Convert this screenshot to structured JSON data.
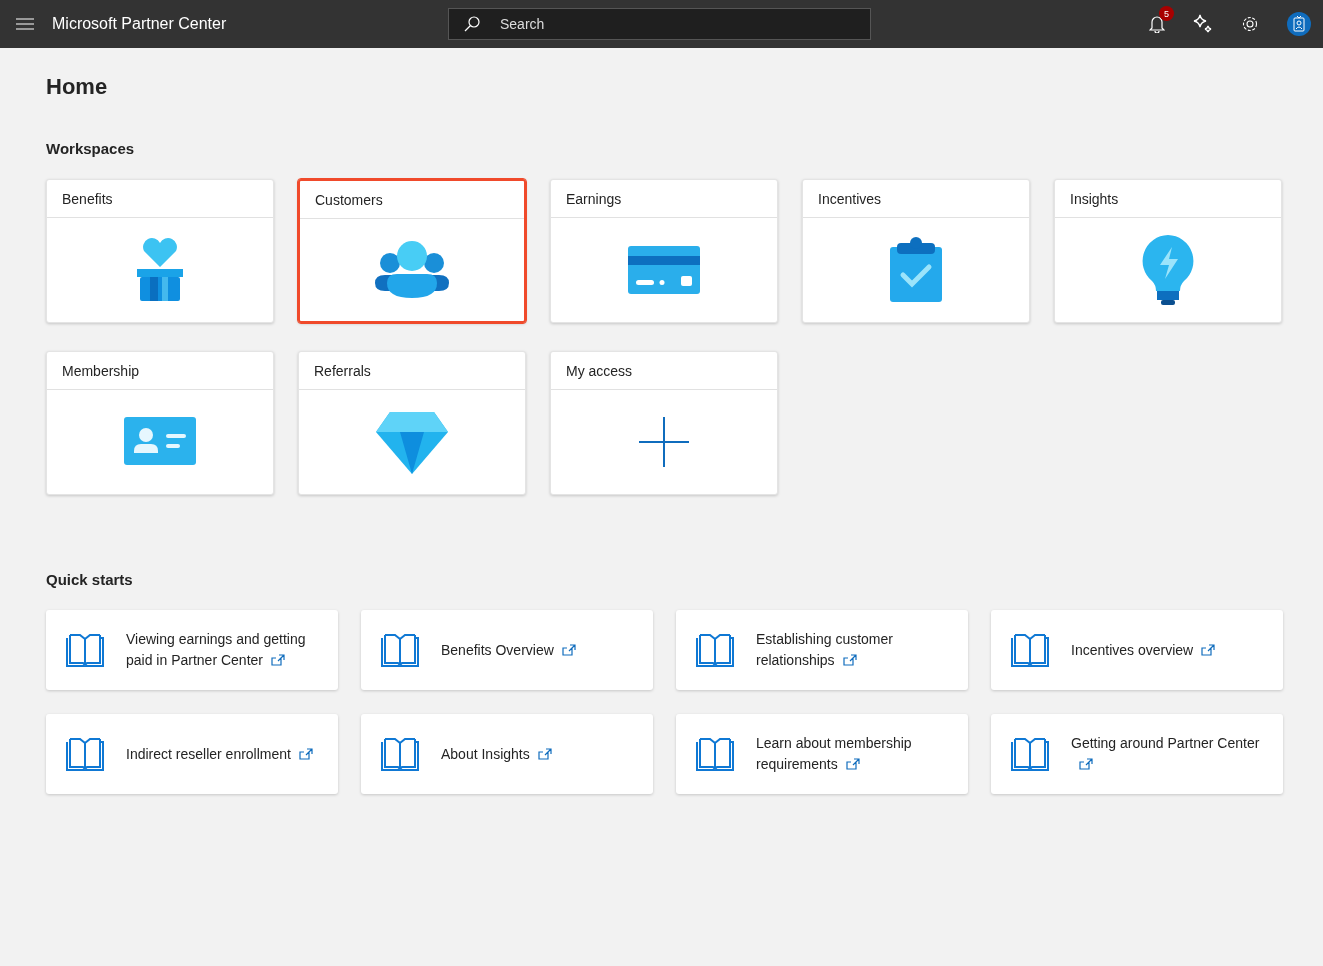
{
  "header": {
    "title": "Microsoft Partner Center",
    "search": {
      "placeholder": "Search"
    },
    "notifications": {
      "count": "5"
    }
  },
  "page": {
    "title": "Home"
  },
  "workspaces": {
    "heading": "Workspaces",
    "items": [
      {
        "label": "Benefits",
        "kind": "benefits",
        "selected": false
      },
      {
        "label": "Customers",
        "kind": "customers",
        "selected": true
      },
      {
        "label": "Earnings",
        "kind": "earnings",
        "selected": false
      },
      {
        "label": "Incentives",
        "kind": "incentives",
        "selected": false
      },
      {
        "label": "Insights",
        "kind": "insights",
        "selected": false
      },
      {
        "label": "Membership",
        "kind": "membership",
        "selected": false
      },
      {
        "label": "Referrals",
        "kind": "referrals",
        "selected": false
      },
      {
        "label": "My access",
        "kind": "add",
        "selected": false
      }
    ]
  },
  "quick_starts": {
    "heading": "Quick starts",
    "items": [
      {
        "title": "Viewing earnings and getting paid in Partner Center"
      },
      {
        "title": "Benefits Overview"
      },
      {
        "title": "Establishing customer relationships"
      },
      {
        "title": "Incentives overview"
      },
      {
        "title": "Indirect reseller enrollment"
      },
      {
        "title": "About Insights"
      },
      {
        "title": "Learn about membership requirements"
      },
      {
        "title": "Getting around Partner Center"
      }
    ]
  }
}
